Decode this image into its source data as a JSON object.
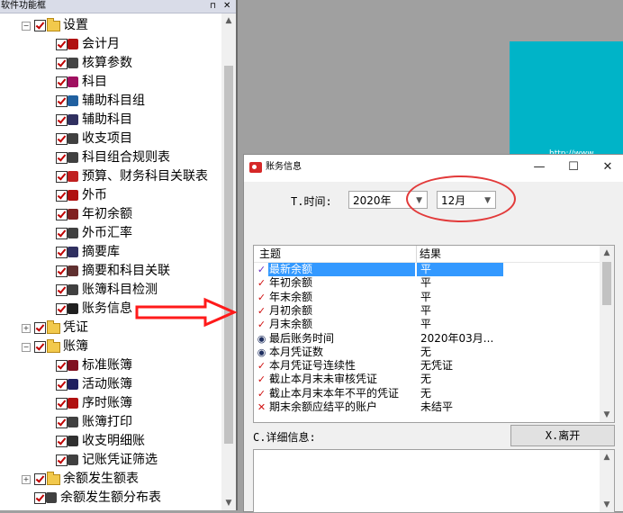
{
  "panel": {
    "title": "软件功能框",
    "pin": "⊓",
    "close": "✕"
  },
  "tree": [
    {
      "label": "设置",
      "type": "folder",
      "level": 0,
      "expander": "−",
      "icon": "folder-icon"
    },
    {
      "label": "会计月",
      "type": "item",
      "level": 1,
      "icon": "calendar-icon",
      "color": "#b01010"
    },
    {
      "label": "核算参数",
      "type": "item",
      "level": 1,
      "icon": "pen-icon",
      "color": "#444444"
    },
    {
      "label": "科目",
      "type": "item",
      "level": 1,
      "icon": "book-icon",
      "color": "#a01060"
    },
    {
      "label": "辅助科目组",
      "type": "item",
      "level": 1,
      "icon": "stamp-icon",
      "color": "#2060a0"
    },
    {
      "label": "辅助科目",
      "type": "item",
      "level": 1,
      "icon": "stamp-icon",
      "color": "#303060"
    },
    {
      "label": "收支项目",
      "type": "item",
      "level": 1,
      "icon": "card-icon",
      "color": "#404040"
    },
    {
      "label": "科目组合规则表",
      "type": "item",
      "level": 1,
      "icon": "grid-icon",
      "color": "#404040"
    },
    {
      "label": "预算、财务科目关联表",
      "type": "item",
      "level": 1,
      "icon": "link-icon",
      "color": "#c02020"
    },
    {
      "label": "外币",
      "type": "item",
      "level": 1,
      "icon": "currency-icon",
      "color": "#b01010"
    },
    {
      "label": "年初余额",
      "type": "item",
      "level": 1,
      "icon": "ledger-icon",
      "color": "#802020"
    },
    {
      "label": "外币汇率",
      "type": "item",
      "level": 1,
      "icon": "rate-icon",
      "color": "#404040"
    },
    {
      "label": "摘要库",
      "type": "item",
      "level": 1,
      "icon": "library-icon",
      "color": "#303060"
    },
    {
      "label": "摘要和科目关联",
      "type": "item",
      "level": 1,
      "icon": "relation-icon",
      "color": "#603030"
    },
    {
      "label": "账簿科目检测",
      "type": "item",
      "level": 1,
      "icon": "check-icon",
      "color": "#404040"
    },
    {
      "label": "账务信息",
      "type": "item",
      "level": 1,
      "icon": "info-book-icon",
      "color": "#202020"
    },
    {
      "label": "凭证",
      "type": "folder",
      "level": 0,
      "expander": "+",
      "icon": "folder-icon"
    },
    {
      "label": "账簿",
      "type": "folder",
      "level": 0,
      "expander": "−",
      "icon": "folder-icon"
    },
    {
      "label": "标准账簿",
      "type": "item",
      "level": 1,
      "icon": "ledger-icon",
      "color": "#801020"
    },
    {
      "label": "活动账簿",
      "type": "item",
      "level": 1,
      "icon": "grid-icon",
      "color": "#202060"
    },
    {
      "label": "序时账簿",
      "type": "item",
      "level": 1,
      "icon": "calendar-icon",
      "color": "#b01010"
    },
    {
      "label": "账簿打印",
      "type": "item",
      "level": 1,
      "icon": "printer-icon",
      "color": "#404040"
    },
    {
      "label": "收支明细账",
      "type": "item",
      "level": 1,
      "icon": "detail-icon",
      "color": "#303030"
    },
    {
      "label": "记账凭证筛选",
      "type": "item",
      "level": 1,
      "icon": "filter-icon",
      "color": "#404040"
    },
    {
      "label": "余额发生额表",
      "type": "folder",
      "level": 0,
      "expander": "+",
      "icon": "folder-icon"
    },
    {
      "label": "余额发生额分布表",
      "type": "item",
      "level": 0,
      "icon": "table-icon",
      "color": "#404040"
    }
  ],
  "canvas": {
    "teal_text": "http://www"
  },
  "dialog": {
    "title": "账务信息",
    "minimize": "—",
    "maximize": "☐",
    "close": "✕",
    "time_label": "T.时间:",
    "year_value": "2020年",
    "month_value": "12月",
    "list_headers": {
      "topic": "主题",
      "result": "结果"
    },
    "rows": [
      {
        "topic": "最新余额",
        "result": "平",
        "icon": "check-mark",
        "mark": "✓",
        "color": "#6a2ec0",
        "selected": true
      },
      {
        "topic": "年初余额",
        "result": "平",
        "icon": "check-mark",
        "mark": "✓",
        "color": "#d01010"
      },
      {
        "topic": "年末余额",
        "result": "平",
        "icon": "check-mark",
        "mark": "✓",
        "color": "#d01010"
      },
      {
        "topic": "月初余额",
        "result": "平",
        "icon": "check-mark",
        "mark": "✓",
        "color": "#d01010"
      },
      {
        "topic": "月末余额",
        "result": "平",
        "icon": "check-mark",
        "mark": "✓",
        "color": "#d01010"
      },
      {
        "topic": "最后账务时间",
        "result": "2020年03月...",
        "icon": "eye-icon",
        "mark": "◉",
        "color": "#203060"
      },
      {
        "topic": "本月凭证数",
        "result": "无",
        "icon": "eye-icon",
        "mark": "◉",
        "color": "#203060"
      },
      {
        "topic": "本月凭证号连续性",
        "result": "无凭证",
        "icon": "check-mark",
        "mark": "✓",
        "color": "#d01010"
      },
      {
        "topic": "截止本月末未审核凭证",
        "result": "无",
        "icon": "check-mark",
        "mark": "✓",
        "color": "#d01010"
      },
      {
        "topic": "截止本月末本年不平的凭证",
        "result": "无",
        "icon": "check-mark",
        "mark": "✓",
        "color": "#d01010"
      },
      {
        "topic": "期末余额应结平的账户",
        "result": "未结平",
        "icon": "cross-icon",
        "mark": "✕",
        "color": "#d01010"
      }
    ],
    "detail_label": "C.详细信息:",
    "leave_button": "X.离开"
  }
}
